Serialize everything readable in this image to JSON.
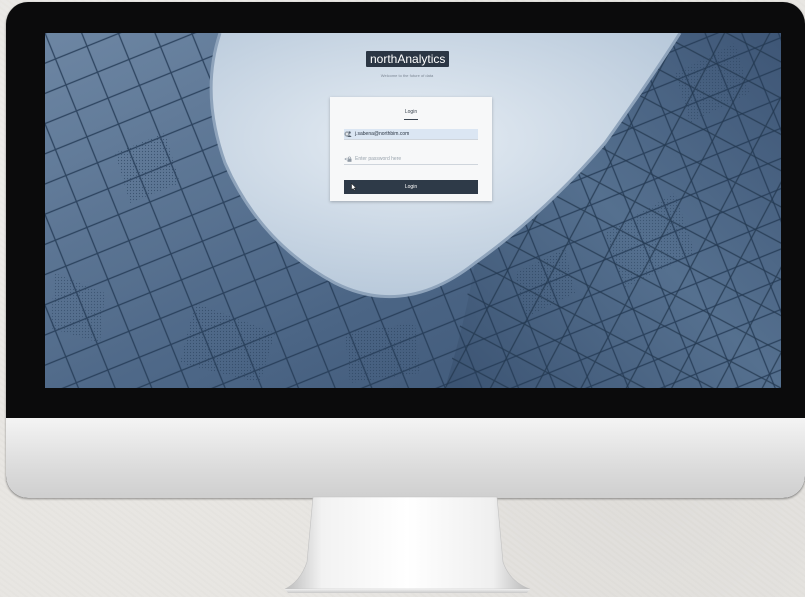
{
  "app": {
    "brand_name": "northAnalytics",
    "tagline": "Welcome to the future of data"
  },
  "login": {
    "tab_label": "Login",
    "username_value": "j.sabena@northbim.com",
    "password_placeholder": "Enter password here",
    "submit_label": "Login"
  },
  "icons": {
    "user": "person-icon",
    "lock": "lock-icon",
    "clear": "close-icon",
    "reveal": "eye-icon",
    "cursor": "mouse-pointer-icon"
  },
  "colors": {
    "brand_bg": "#2b3644",
    "button_bg": "#2e3a48",
    "input_highlight": "#dbe6f3",
    "bezel": "#0b0b0c"
  }
}
